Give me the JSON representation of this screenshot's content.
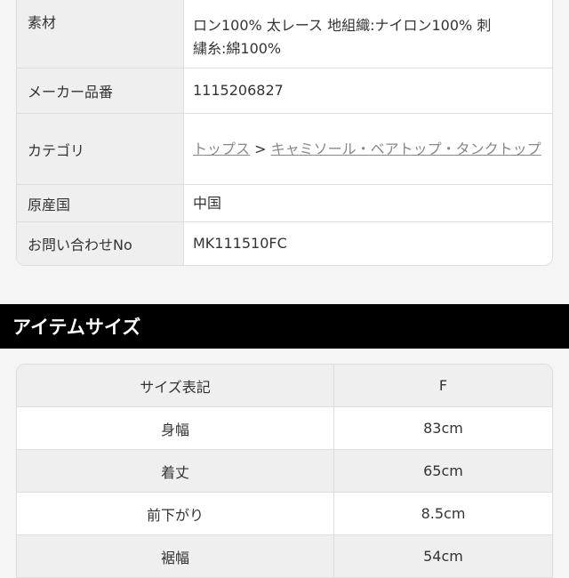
{
  "details": [
    {
      "label": "素材",
      "lines": [
        "ロン100% 太レース 地組織:ナイロン100% 刺",
        "繍糸:綿100%"
      ]
    },
    {
      "label": "メーカー品番",
      "value": "1115206827"
    },
    {
      "label": "カテゴリ",
      "links": [
        "トップス",
        "キャミソール・ベアトップ・タンクトップ"
      ],
      "separator": " > "
    },
    {
      "label": "原産国",
      "value": "中国"
    },
    {
      "label": "お問い合わせNo",
      "value": "MK111510FC"
    }
  ],
  "size_section": {
    "title": "アイテムサイズ",
    "header": [
      "サイズ表記",
      "F"
    ],
    "rows": [
      [
        "身幅",
        "83cm"
      ],
      [
        "着丈",
        "65cm"
      ],
      [
        "前下がり",
        "8.5cm"
      ],
      [
        "裾幅",
        "54cm"
      ]
    ]
  }
}
